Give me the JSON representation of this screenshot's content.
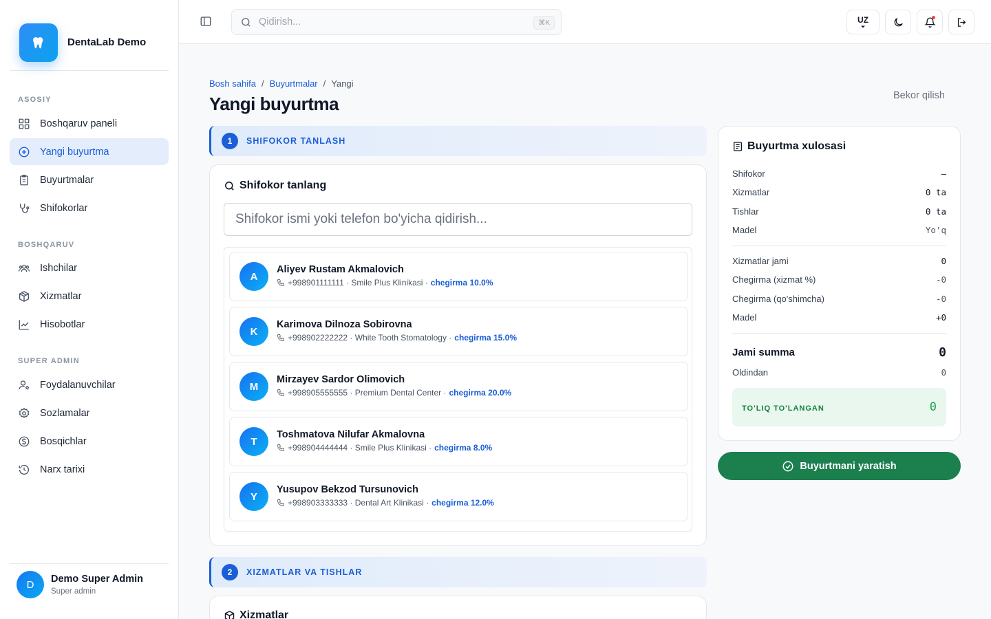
{
  "brand": {
    "name": "DentaLab Demo"
  },
  "sidebar": {
    "sections": [
      {
        "title": "ASOSIY",
        "items": [
          {
            "label": "Boshqaruv paneli",
            "icon": "grid-icon"
          },
          {
            "label": "Yangi buyurtma",
            "icon": "plus-circle-icon",
            "active": true
          },
          {
            "label": "Buyurtmalar",
            "icon": "clipboard-icon"
          },
          {
            "label": "Shifokorlar",
            "icon": "stethoscope-icon"
          }
        ]
      },
      {
        "title": "BOSHQARUV",
        "items": [
          {
            "label": "Ishchilar",
            "icon": "users-icon"
          },
          {
            "label": "Xizmatlar",
            "icon": "package-icon"
          },
          {
            "label": "Hisobotlar",
            "icon": "chart-line-icon"
          }
        ]
      },
      {
        "title": "SUPER ADMIN",
        "items": [
          {
            "label": "Foydalanuvchilar",
            "icon": "user-cog-icon"
          },
          {
            "label": "Sozlamalar",
            "icon": "gear-icon"
          },
          {
            "label": "Bosqichlar",
            "icon": "dollar-circle-icon"
          },
          {
            "label": "Narx tarixi",
            "icon": "history-icon"
          }
        ]
      }
    ]
  },
  "user": {
    "initial": "D",
    "name": "Demo Super Admin",
    "role": "Super admin"
  },
  "topbar": {
    "search_placeholder": "Qidirish...",
    "search_shortcut": "⌘K",
    "language": "UZ"
  },
  "page": {
    "breadcrumb": [
      "Bosh sahifa",
      "Buyurtmalar",
      "Yangi"
    ],
    "title": "Yangi buyurtma",
    "cancel_label": "Bekor qilish"
  },
  "steps": [
    {
      "num": "1",
      "label": "SHIFOKOR TANLASH"
    },
    {
      "num": "2",
      "label": "XIZMATLAR VA TISHLAR"
    }
  ],
  "doctor_card": {
    "title": "Shifokor tanlang",
    "search_placeholder": "Shifokor ismi yoki telefon bo'yicha qidirish...",
    "doctors": [
      {
        "initial": "A",
        "name": "Aliyev Rustam Akmalovich",
        "meta": "+998901111111 · Smile Plus Klinikasi ·",
        "discount": "chegirma 10.0%"
      },
      {
        "initial": "K",
        "name": "Karimova Dilnoza Sobirovna",
        "meta": "+998902222222 · White Tooth Stomatology ·",
        "discount": "chegirma 15.0%"
      },
      {
        "initial": "M",
        "name": "Mirzayev Sardor Olimovich",
        "meta": "+998905555555 · Premium Dental Center ·",
        "discount": "chegirma 20.0%"
      },
      {
        "initial": "T",
        "name": "Toshmatova Nilufar Akmalovna",
        "meta": "+998904444444 · Smile Plus Klinikasi ·",
        "discount": "chegirma 8.0%"
      },
      {
        "initial": "Y",
        "name": "Yusupov Bekzod Tursunovich",
        "meta": "+998903333333 · Dental Art Klinikasi ·",
        "discount": "chegirma 12.0%"
      }
    ]
  },
  "services_card": {
    "title": "Xizmatlar"
  },
  "summary": {
    "title": "Buyurtma xulosasi",
    "rows_top": [
      {
        "label": "Shifokor",
        "value": "—"
      },
      {
        "label": "Xizmatlar",
        "value": "0 ta"
      },
      {
        "label": "Tishlar",
        "value": "0 ta"
      },
      {
        "label": "Madel",
        "value": "Yo'q"
      }
    ],
    "rows_mid": [
      {
        "label": "Xizmatlar jami",
        "value": "0"
      },
      {
        "label": "Chegirma (xizmat %)",
        "value": "-0"
      },
      {
        "label": "Chegirma (qo'shimcha)",
        "value": "-0"
      },
      {
        "label": "Madel",
        "value": "+0"
      }
    ],
    "total_label": "Jami summa",
    "total_value": "0",
    "advance_label": "Oldindan",
    "advance_value": "0",
    "paid_label": "TO'LIQ TO'LANGAN",
    "paid_value": "0"
  },
  "create_button": {
    "label": "Buyurtmani yaratish"
  },
  "colors": {
    "primary": "#1a5ed8",
    "success": "#1b7f4e",
    "active_bg": "#e3edfc"
  }
}
